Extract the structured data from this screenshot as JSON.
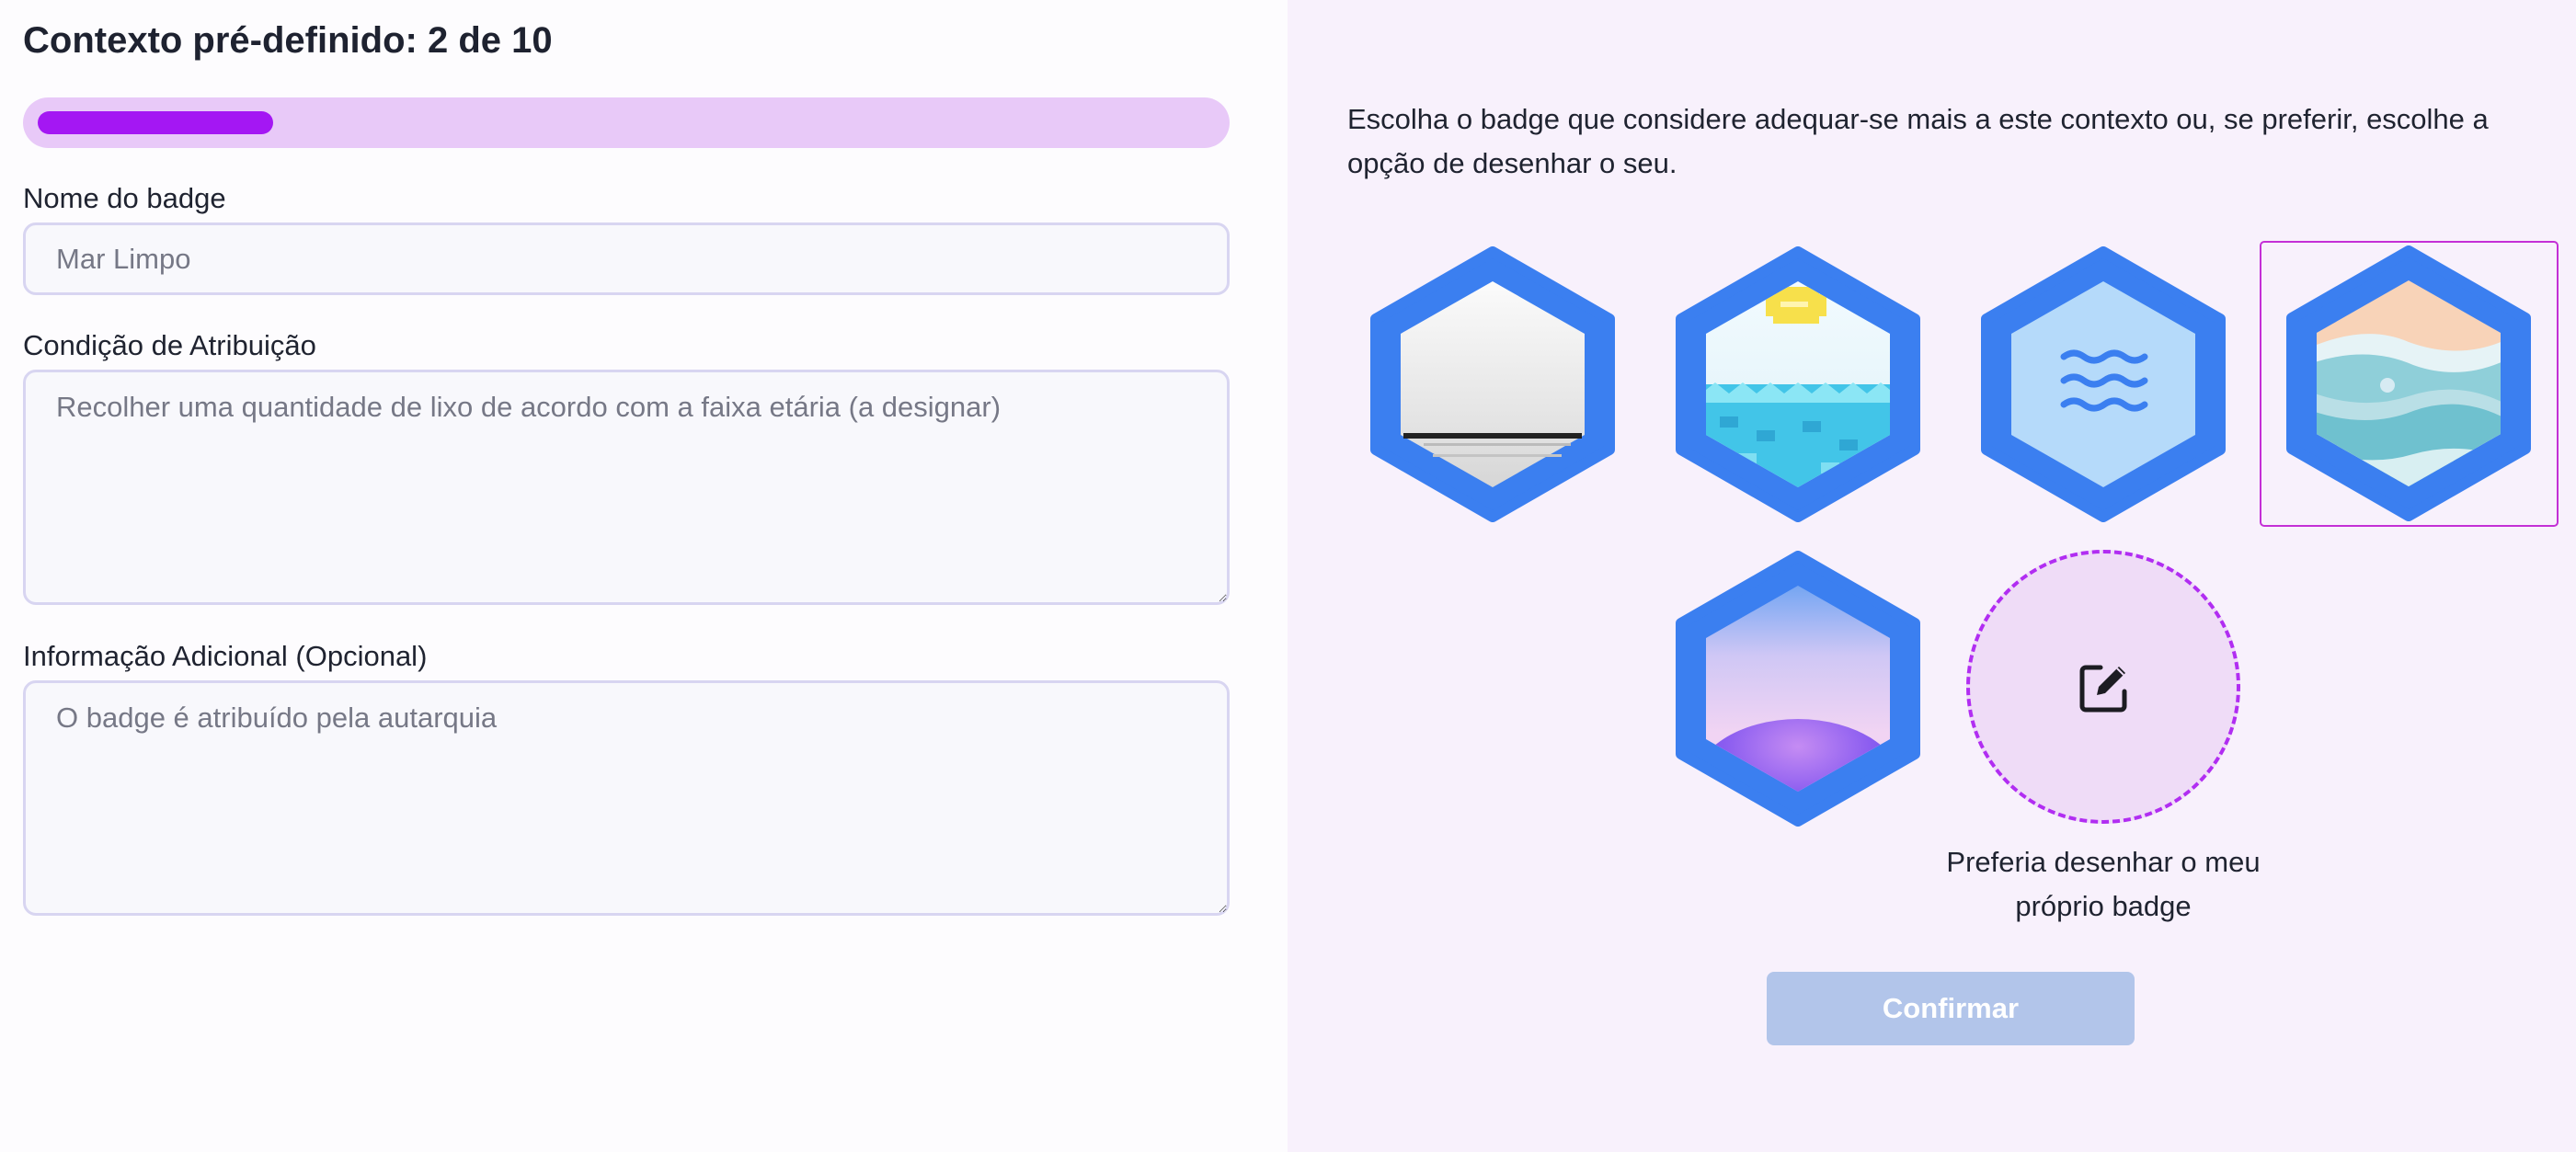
{
  "form": {
    "title": "Contexto pré-definido: 2 de 10",
    "progress": {
      "current": 2,
      "total": 10,
      "fraction": 0.2
    },
    "badge_name": {
      "label": "Nome do badge",
      "value": "Mar Limpo"
    },
    "attribution_condition": {
      "label": "Condição de Atribuição",
      "value": "Recolher uma quantidade de lixo de acordo com a faixa etária (a designar)"
    },
    "additional_info": {
      "label": "Informação Adicional (Opcional)",
      "value": "O badge é atribuído pela autarquia"
    }
  },
  "picker": {
    "instructions": "Escolha o badge que considere adequar-se mais a este contexto ou, se preferir, escolhe a opção de desenhar o seu.",
    "badges": [
      {
        "icon": "grey-beach-badge-icon",
        "selected": false
      },
      {
        "icon": "pixel-sun-sea-badge-icon",
        "selected": false
      },
      {
        "icon": "waves-badge-icon",
        "selected": false
      },
      {
        "icon": "pastel-waves-badge-icon",
        "selected": true
      },
      {
        "icon": "purple-horizon-badge-icon",
        "selected": false
      }
    ],
    "draw_own": {
      "icon": "edit-icon",
      "label": "Preferia desenhar o meu próprio badge"
    },
    "confirm_label": "Confirmar",
    "colors": {
      "hex_frame": "#3b7ff0",
      "accent": "#a417f3",
      "selection_outline": "#c42fd6",
      "confirm_disabled": "#b2c5ea"
    }
  }
}
